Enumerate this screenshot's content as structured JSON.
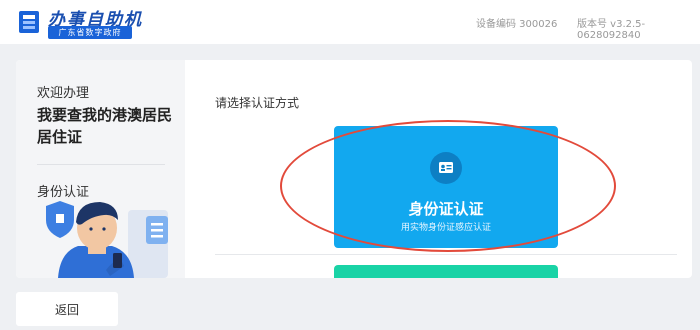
{
  "header": {
    "brand_title": "办事自助机",
    "brand_subtitle": "广东省数字政府",
    "device_code": "设备编码 300026",
    "version": "版本号 v3.2.5-0628092840"
  },
  "sidebar": {
    "welcome": "欢迎办理",
    "service_title": "我要查我的港澳居民居住证",
    "current_step": "身份认证"
  },
  "main": {
    "prompt": "请选择认证方式",
    "options": [
      {
        "title": "身份证认证",
        "subtitle": "用实物身份证感应认证",
        "icon": "id-card-icon",
        "color": "#12a8ef"
      },
      {
        "title": "",
        "subtitle": "",
        "color": "#19d3a6"
      }
    ]
  },
  "footer": {
    "back_label": "返回"
  },
  "colors": {
    "accent_blue": "#12a8ef",
    "accent_green": "#19d3a6",
    "annotation_red": "#e24a3b",
    "brand_blue": "#1a4fb0"
  }
}
